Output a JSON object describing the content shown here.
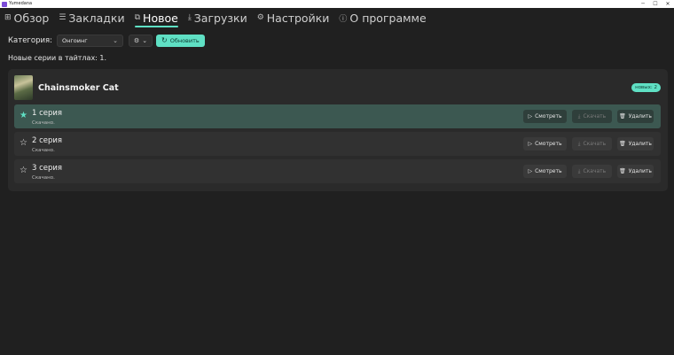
{
  "window": {
    "title": "Yumedana",
    "controls": [
      "─",
      "☐",
      "✕"
    ]
  },
  "nav": {
    "items": [
      {
        "label": "Обзор",
        "icon": "⊞",
        "icon_name": "grid-icon"
      },
      {
        "label": "Закладки",
        "icon": "☰",
        "icon_name": "bookmarks-icon"
      },
      {
        "label": "Новое",
        "icon": "⧉",
        "icon_name": "new-icon",
        "active": true
      },
      {
        "label": "Загрузки",
        "icon": "⤓",
        "icon_name": "download-icon"
      },
      {
        "label": "Настройки",
        "icon": "⚙",
        "icon_name": "gear-icon"
      },
      {
        "label": "О программе",
        "icon": "ⓘ",
        "icon_name": "info-icon"
      }
    ]
  },
  "toolbar": {
    "category_label": "Категория:",
    "category_value": "Онгоинг",
    "filter_icon": "⚙",
    "filter_chev": "⌄",
    "refresh_icon": "↻",
    "refresh_label": "Обновить"
  },
  "summary": "Новые серии в тайтлах: 1.",
  "card": {
    "title": "Chainsmoker Cat",
    "badge": "новых: 2",
    "episodes": [
      {
        "title": "1 серия",
        "status": "Скачано.",
        "star": "★",
        "active": true
      },
      {
        "title": "2 серия",
        "status": "Скачано.",
        "star": "☆",
        "active": false
      },
      {
        "title": "3 серия",
        "status": "Скачано.",
        "star": "☆",
        "active": false
      }
    ],
    "actions": {
      "watch_icon": "▷",
      "watch_label": "Смотреть",
      "download_icon": "⤓",
      "download_label": "Скачать",
      "delete_icon": "🗑",
      "delete_label": "Удалить"
    }
  },
  "colors": {
    "accent": "#5fe0c4",
    "background": "#202020",
    "card": "#2a2a2a",
    "active_row": "#3c5851"
  }
}
